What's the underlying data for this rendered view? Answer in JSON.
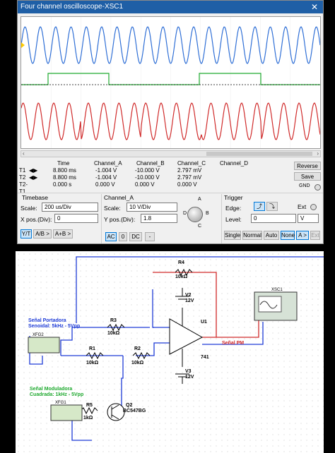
{
  "window": {
    "title": "Four channel oscilloscope-XSC1",
    "close": "✕"
  },
  "measurements": {
    "headers": {
      "time": "Time",
      "a": "Channel_A",
      "b": "Channel_B",
      "c": "Channel_C",
      "d": "Channel_D"
    },
    "rows": [
      {
        "label": "T1",
        "time": "8.800 ms",
        "a": "-1.004 V",
        "b": "-10.000 V",
        "c": "2.797 mV",
        "d": ""
      },
      {
        "label": "T2",
        "time": "8.800 ms",
        "a": "-1.004 V",
        "b": "-10.000 V",
        "c": "2.797 mV",
        "d": ""
      },
      {
        "label": "T2-T1",
        "time": "0.000 s",
        "a": "0.000 V",
        "b": "0.000 V",
        "c": "0.000 V",
        "d": ""
      }
    ],
    "reverse": "Reverse",
    "save": "Save",
    "gnd": "GND"
  },
  "timebase": {
    "title": "Timebase",
    "scale_label": "Scale:",
    "scale": "200 us/Div",
    "xpos_label": "X pos.(Div):",
    "xpos": "0",
    "buttons": [
      "Y/T",
      "A/B >",
      "A+B >"
    ]
  },
  "channel": {
    "title": "Channel_A",
    "scale_label": "Scale:",
    "scale": "10  V/Div",
    "ypos_label": "Y pos.(Div):",
    "ypos": "1.8",
    "buttons": [
      "AC",
      "0",
      "DC",
      "-"
    ],
    "knob": {
      "a": "A",
      "b": "B",
      "c": "C",
      "d": "D"
    }
  },
  "trigger": {
    "title": "Trigger",
    "edge_label": "Edge:",
    "edge_rise": "⤴",
    "edge_fall": "⤵",
    "ext": "Ext",
    "level_label": "Level:",
    "level": "0",
    "level_unit": "V",
    "buttons": [
      "Single",
      "Normal",
      "Auto",
      "None",
      "A >",
      "Ext"
    ]
  },
  "circuit": {
    "r4": {
      "name": "R4",
      "value": "10kΩ"
    },
    "v2": {
      "name": "V2",
      "value": "12V"
    },
    "r3": {
      "name": "R3",
      "value": "10kΩ"
    },
    "u1": "U1",
    "op": "741",
    "r1": {
      "name": "R1",
      "value": "10kΩ"
    },
    "r2": {
      "name": "R2",
      "value": "10kΩ"
    },
    "v3": {
      "name": "V3",
      "value": "12V"
    },
    "q2": {
      "name": "Q2",
      "value": "BC547BG"
    },
    "r5": {
      "name": "R5",
      "value": "1kΩ"
    },
    "xfg2": "XFG2",
    "xfg1": "XFG1",
    "xsc1": "XSC1",
    "carrier_label1": "Señal Portadora",
    "carrier_label2": "Senoidal: 5kHz - 5Vpp",
    "mod_label1": "Señal Moduladora",
    "mod_label2": "Cuadrada: 1kHz - 5Vpp",
    "pm_label": "Señal PM"
  },
  "colors": {
    "accent": "#1f5fa6",
    "ch_a": "#2f6fd6",
    "ch_b": "#1faa2f",
    "ch_c": "#d02a2a",
    "wire": "#1e3bd6"
  }
}
